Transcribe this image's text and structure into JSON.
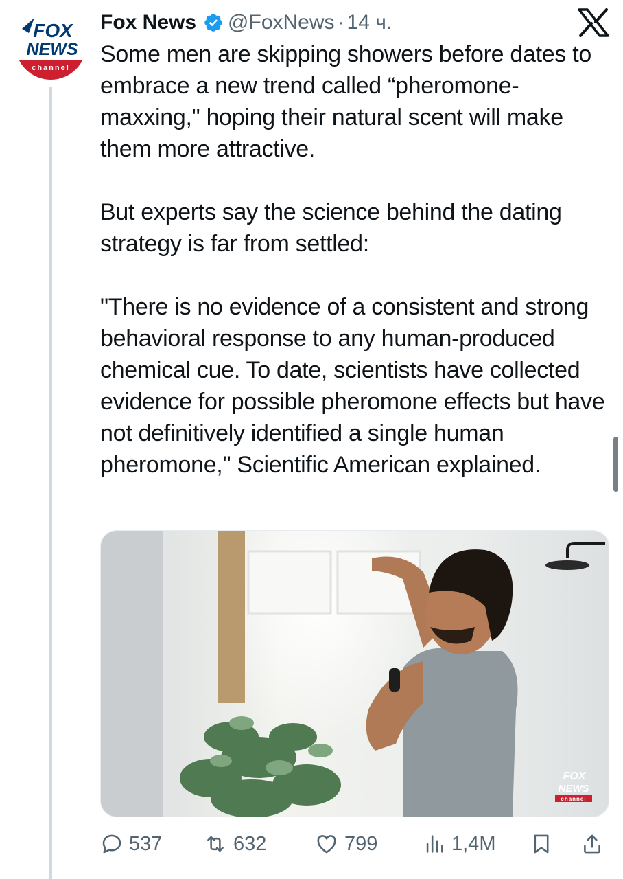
{
  "tweet": {
    "author_name": "Fox News",
    "handle": "@FoxNews",
    "separator": "·",
    "time": "14 ч.",
    "paragraphs": [
      "Some men are skipping showers before dates to embrace a new trend called “pheromone-maxxing,\" hoping their natural scent will make them more attractive.",
      "But experts say the science behind the dating strategy is far from settled:",
      "\"There is no evidence of a consistent and strong behavioral response to any human-produced chemical cue. To date, scientists have collected evidence for possible pheromone effects but have not definitively identified a single human pheromone,\" Scientific American explained."
    ]
  },
  "avatar": {
    "logo_line1": "FOX",
    "logo_line2": "NEWS",
    "logo_line3": "channel"
  },
  "media": {
    "watermark_line1": "FOX",
    "watermark_line2": "NEWS",
    "watermark_line3": "channel"
  },
  "actions": {
    "replies": "537",
    "reposts": "632",
    "likes": "799",
    "views": "1,4M"
  },
  "icons": [
    "verified-badge-icon",
    "x-logo-icon",
    "reply-icon",
    "repost-icon",
    "like-icon",
    "views-icon",
    "bookmark-icon",
    "share-icon"
  ],
  "colors": {
    "verified": "#1d9bf0",
    "muted": "#536471",
    "fox_blue": "#003366",
    "fox_red": "#cc1f2f"
  }
}
